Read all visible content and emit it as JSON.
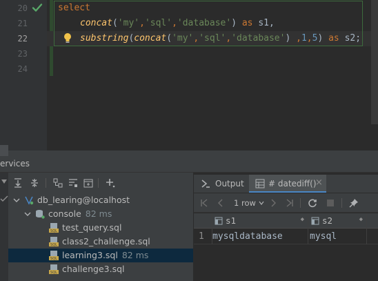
{
  "editor": {
    "line_numbers": [
      "20",
      "21",
      "22",
      "23",
      "24"
    ],
    "line20": {
      "kw_select": "select"
    },
    "line21": {
      "fn_concat": "concat",
      "open": "(",
      "s1": "'my'",
      "c1": ",",
      "s2": "'sql'",
      "c2": ",",
      "s3": "'database'",
      "close": ")",
      "kw_as": "as",
      "alias": "s1,"
    },
    "line22": {
      "fn_substring": "substring",
      "open1": "(",
      "fn_concat": "concat",
      "open2": "(",
      "s1": "'my'",
      "c1": ",",
      "s2": "'sql'",
      "c2": ",",
      "s3": "'database'",
      "close2": ")",
      "args_pre": ",",
      "n1": "1",
      "args_mid": ",",
      "n2": "5",
      "close1": ")",
      "kw_as": "as",
      "alias": "s2;"
    },
    "check_icon": "checkmark-icon",
    "intention_icon": "lightbulb-icon"
  },
  "services": {
    "title": "ervices",
    "tree": [
      {
        "label": "db_learing@localhost",
        "meta": "",
        "icon": "datasource-icon"
      },
      {
        "label": "console",
        "meta": "82 ms",
        "icon": "console-icon"
      },
      {
        "label": "test_query.sql",
        "meta": "",
        "icon": "sql-file-icon"
      },
      {
        "label": "class2_challenge.sql",
        "meta": "",
        "icon": "sql-file-icon"
      },
      {
        "label": "learning3.sql",
        "meta": "82 ms",
        "icon": "sql-file-icon"
      },
      {
        "label": "challenge3.sql",
        "meta": "",
        "icon": "sql-file-icon"
      }
    ]
  },
  "results": {
    "tabs": [
      {
        "label": "Output",
        "icon": "output-icon"
      },
      {
        "label": "# datediff()",
        "icon": "table-icon"
      }
    ],
    "tab_close": "×",
    "rows_label": "1 row",
    "columns": [
      "s1",
      "s2"
    ],
    "rows": [
      {
        "num": "1",
        "cells": [
          "mysqldatabase",
          "mysql"
        ]
      }
    ]
  },
  "colors": {
    "editor_bg": "#2b2b2b",
    "panel_bg": "#3c3f41",
    "keyword": "#cc7832",
    "function": "#ffc66d",
    "string": "#6a8759",
    "number": "#6897bb",
    "selection": "#0d293e",
    "accent": "#4a88c7"
  }
}
